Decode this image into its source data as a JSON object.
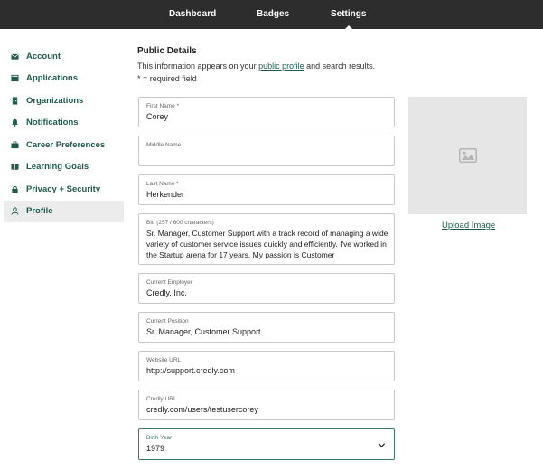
{
  "topnav": {
    "tabs": [
      {
        "label": "Dashboard",
        "active": false
      },
      {
        "label": "Badges",
        "active": false
      },
      {
        "label": "Settings",
        "active": true
      }
    ]
  },
  "sidebar": {
    "items": [
      {
        "label": "Account",
        "icon": "envelope-icon",
        "active": false
      },
      {
        "label": "Applications",
        "icon": "application-icon",
        "active": false
      },
      {
        "label": "Organizations",
        "icon": "building-icon",
        "active": false
      },
      {
        "label": "Notifications",
        "icon": "bell-icon",
        "active": false
      },
      {
        "label": "Career Preferences",
        "icon": "briefcase-icon",
        "active": false
      },
      {
        "label": "Learning Goals",
        "icon": "book-icon",
        "active": false
      },
      {
        "label": "Privacy + Security",
        "icon": "lock-icon",
        "active": false
      },
      {
        "label": "Profile",
        "icon": "user-icon",
        "active": true
      }
    ]
  },
  "main": {
    "heading": "Public Details",
    "info_prefix": "This information appears on your",
    "info_link": "public profile",
    "info_suffix": "and search results.",
    "required_note": "* = required field",
    "fields": {
      "first_name": {
        "label": "First Name *",
        "value": "Corey"
      },
      "middle_name": {
        "label": "Middle Name",
        "value": ""
      },
      "last_name": {
        "label": "Last Name *",
        "value": "Herkender"
      },
      "bio": {
        "label": "Bio (257 / 600 characters)",
        "value": "Sr. Manager, Customer Support with a track record of managing a wide variety of customer service issues quickly and efficiently. I've worked in the Startup arena for 17 years. My passion is Customer"
      },
      "employer": {
        "label": "Current Employer",
        "value": "Credly, Inc."
      },
      "position": {
        "label": "Current Position",
        "value": "Sr. Manager, Customer Support"
      },
      "website": {
        "label": "Website URL",
        "value": "http://support.credly.com"
      },
      "credly_url": {
        "label": "Credly URL",
        "value": "credly.com/users/testusercorey"
      },
      "birth_year": {
        "label": "Birth Year",
        "value": "1979"
      }
    },
    "image": {
      "icon": "image-placeholder-icon",
      "upload_label": "Upload Image"
    }
  },
  "colors": {
    "topbar": "#2d2d2d",
    "accent": "#1f5c4e",
    "focus_border": "#3b7a6a",
    "sidebar_active": "#ececec",
    "image_placeholder": "#e6e6e6"
  }
}
